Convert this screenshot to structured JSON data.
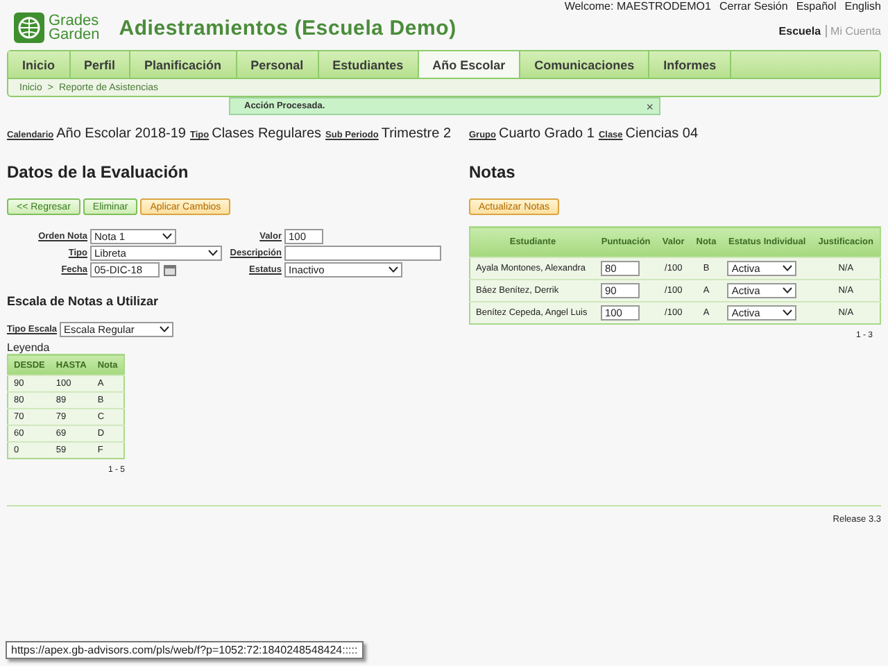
{
  "header": {
    "logo": [
      "Grades",
      "Garden"
    ],
    "title": "Adiestramientos (Escuela Demo)",
    "user_links": [
      "Welcome: MAESTRODEMO1",
      "Cerrar Sesión",
      "Español",
      "English"
    ],
    "account_links": [
      {
        "label": "Escuela",
        "selected": true
      },
      {
        "label": "Mi Cuenta",
        "selected": false
      }
    ]
  },
  "tabs": [
    {
      "label": "Inicio",
      "selected": false
    },
    {
      "label": "Perfil",
      "selected": false
    },
    {
      "label": "Planificación",
      "selected": false
    },
    {
      "label": "Personal",
      "selected": false
    },
    {
      "label": "Estudiantes",
      "selected": false
    },
    {
      "label": "Año Escolar",
      "selected": true
    },
    {
      "label": "Comunicaciones",
      "selected": false
    },
    {
      "label": "Informes",
      "selected": false
    }
  ],
  "breadcrumb": {
    "items": [
      "Inicio",
      "Reporte de Asistencias"
    ],
    "separator": ">"
  },
  "message": {
    "text": "Acción Procesada.",
    "close": "×"
  },
  "context_left": [
    {
      "label": "Calendario",
      "value": "Año Escolar 2018-19"
    },
    {
      "label": "Tipo",
      "value": "Clases Regulares"
    },
    {
      "label": "Sub Periodo",
      "value": "Trimestre 2"
    }
  ],
  "context_right": [
    {
      "label": "Grupo",
      "value": "Cuarto Grado 1"
    },
    {
      "label": "Clase",
      "value": "Ciencias 04"
    }
  ],
  "evaluation": {
    "title": "Datos de la Evaluación",
    "buttons": [
      {
        "label": "<< Regresar",
        "kind": "green"
      },
      {
        "label": "Eliminar",
        "kind": "green"
      },
      {
        "label": "Aplicar Cambios",
        "kind": "orange"
      }
    ],
    "fields": [
      {
        "label": "Orden Nota",
        "kind": "select",
        "value": "Nota 1"
      },
      {
        "label": "Valor",
        "kind": "input",
        "value": "100"
      },
      {
        "label": "Tipo",
        "kind": "select",
        "value": "Libreta"
      },
      {
        "label": "Descripción",
        "kind": "input"
      },
      {
        "label": "Fecha",
        "kind": "date",
        "value": "05-DIC-18"
      },
      {
        "label": "Estatus",
        "kind": "select",
        "value": "Inactivo"
      }
    ]
  },
  "scale": {
    "title": "Escala de Notas a Utilizar",
    "field": {
      "label": "Tipo Escala",
      "value": "Escala Regular"
    },
    "legend": "Leyenda",
    "columns": [
      "DESDE",
      "HASTA",
      "Nota"
    ],
    "rows": [
      [
        "90",
        "100",
        "A"
      ],
      [
        "80",
        "89",
        "B"
      ],
      [
        "70",
        "79",
        "C"
      ],
      [
        "60",
        "69",
        "D"
      ],
      [
        "0",
        "59",
        "F"
      ]
    ],
    "pagination": "1 - 5"
  },
  "grades": {
    "title": "Notas",
    "button": "Actualizar Notas",
    "columns": [
      "Estudiante",
      "Puntuación",
      "Valor",
      "Nota",
      "Estatus Individual",
      "Justificacion"
    ],
    "rows": [
      {
        "student": "Ayala Montones, Alexandra",
        "score": "80",
        "max": "/100",
        "grade": "B",
        "status": "Activa",
        "justification": "N/A"
      },
      {
        "student": "Báez Benítez, Derrik",
        "score": "90",
        "max": "/100",
        "grade": "A",
        "status": "Activa",
        "justification": "N/A"
      },
      {
        "student": "Benítez Cepeda, Angel Luis",
        "score": "100",
        "max": "/100",
        "grade": "A",
        "status": "Activa",
        "justification": "N/A"
      }
    ],
    "pagination": "1 - 3"
  },
  "footer": {
    "release": "Release 3.3"
  },
  "status_url": "https://apex.gb-advisors.com/pls/web/f?p=1052:72:1840248548424:::::"
}
